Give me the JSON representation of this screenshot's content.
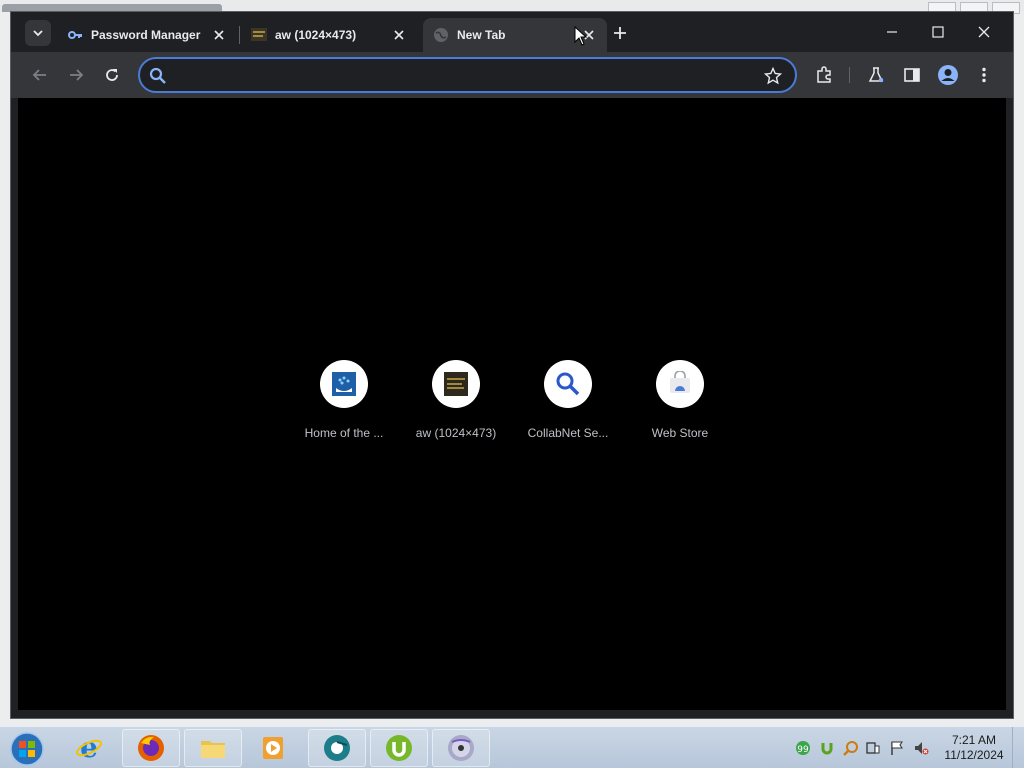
{
  "browser": {
    "tabs": [
      {
        "title": "Password Manager",
        "icon": "key-icon",
        "active": false
      },
      {
        "title": "aw (1024×473)",
        "icon": "image-thumb-icon",
        "active": false
      },
      {
        "title": "New Tab",
        "icon": "globe-icon",
        "active": true
      }
    ],
    "omnibox": {
      "value": "",
      "placeholder": ""
    },
    "accent": "#4a7bd6"
  },
  "shortcuts": [
    {
      "label": "Home of the ...",
      "icon": "home-site-icon"
    },
    {
      "label": "aw (1024×473)",
      "icon": "image-thumb-icon"
    },
    {
      "label": "CollabNet Se...",
      "icon": "magnifier-icon"
    },
    {
      "label": "Web Store",
      "icon": "web-store-icon"
    }
  ],
  "taskbar": {
    "clock": {
      "time": "7:21 AM",
      "date": "11/12/2024"
    },
    "apps": [
      "internet-explorer-icon",
      "firefox-icon",
      "file-explorer-icon",
      "media-player-icon",
      "chrome-app-icon",
      "utorrent-icon",
      "dvd-icon"
    ]
  }
}
